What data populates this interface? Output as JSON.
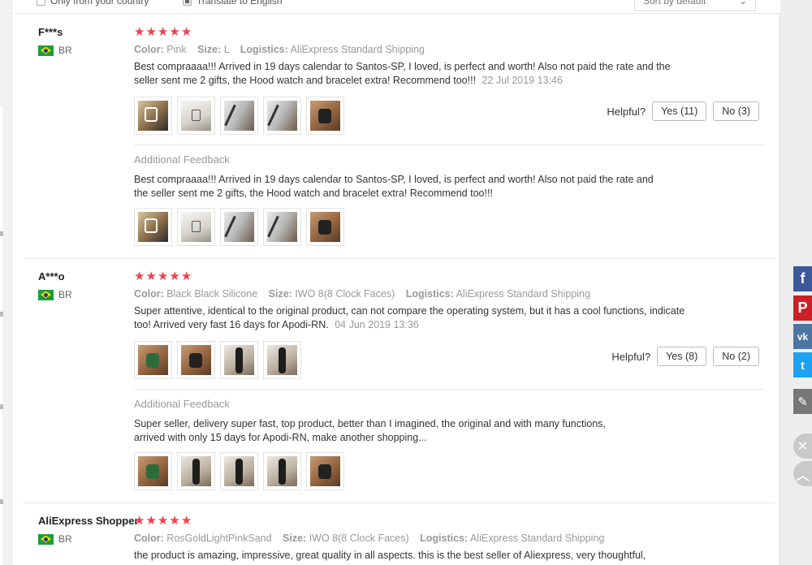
{
  "filters": {
    "only_country_label": "Only from your country",
    "translate_label": "Translate to English",
    "sort_label": "Sort by default"
  },
  "icons": {
    "star": "★",
    "chevron": "⌄"
  },
  "reviews": [
    {
      "user": "F***s",
      "country": "BR",
      "rating": 5,
      "color_label": "Color:",
      "color": "Pink",
      "size_label": "Size:",
      "size": "L",
      "logistics_label": "Logistics:",
      "logistics": "AliExpress Standard Shipping",
      "text": "Best compraaaa!!! Arrived in 19 days calendar to Santos-SP, I loved, is perfect and worth! Also not paid the rate and the seller sent me 2 gifts, the Hood watch and bracelet extra! Recommend too!!!",
      "date": "22 Jul 2019 13:46",
      "helpful_label": "Helpful?",
      "yes": "Yes (11)",
      "no": "No (3)",
      "additional_label": "Additional Feedback",
      "additional_text": "Best compraaaa!!! Arrived in 19 days calendar to Santos-SP, I loved, is perfect and worth! Also not paid the rate and the seller sent me 2 gifts, the Hood watch and bracelet extra! Recommend too!!!"
    },
    {
      "user": "A***o",
      "country": "BR",
      "rating": 5,
      "color_label": "Color:",
      "color": "Black Black Silicone",
      "size_label": "Size:",
      "size": "IWO 8(8 Clock Faces)",
      "logistics_label": "Logistics:",
      "logistics": "AliExpress Standard Shipping",
      "text": "Super attentive, identical to the original product, can not compare the operating system, but it has a cool functions, indicate too! Arrived very fast 16 days for Apodi-RN.",
      "date": "04 Jun 2019 13:36",
      "helpful_label": "Helpful?",
      "yes": "Yes (8)",
      "no": "No (2)",
      "additional_label": "Additional Feedback",
      "additional_text": "Super seller, delivery super fast, top product, better than I imagined, the original and with many functions, arrived with only 15 days for Apodi-RN, make another shopping..."
    },
    {
      "user": "AliExpress Shopper",
      "country": "BR",
      "rating": 5,
      "color_label": "Color:",
      "color": "RosGoldLightPinkSand",
      "size_label": "Size:",
      "size": "IWO 8(8 Clock Faces)",
      "logistics_label": "Logistics:",
      "logistics": "AliExpress Standard Shipping",
      "text": "the product is amazing, impressive, great quality in all aspects. this is the best seller of Aliexpress, very thoughtful,"
    }
  ],
  "social": {
    "facebook": "f",
    "pinterest": "P",
    "vk": "vk",
    "twitter": "t",
    "edit": "✎",
    "close": "✕",
    "top": "︿"
  }
}
